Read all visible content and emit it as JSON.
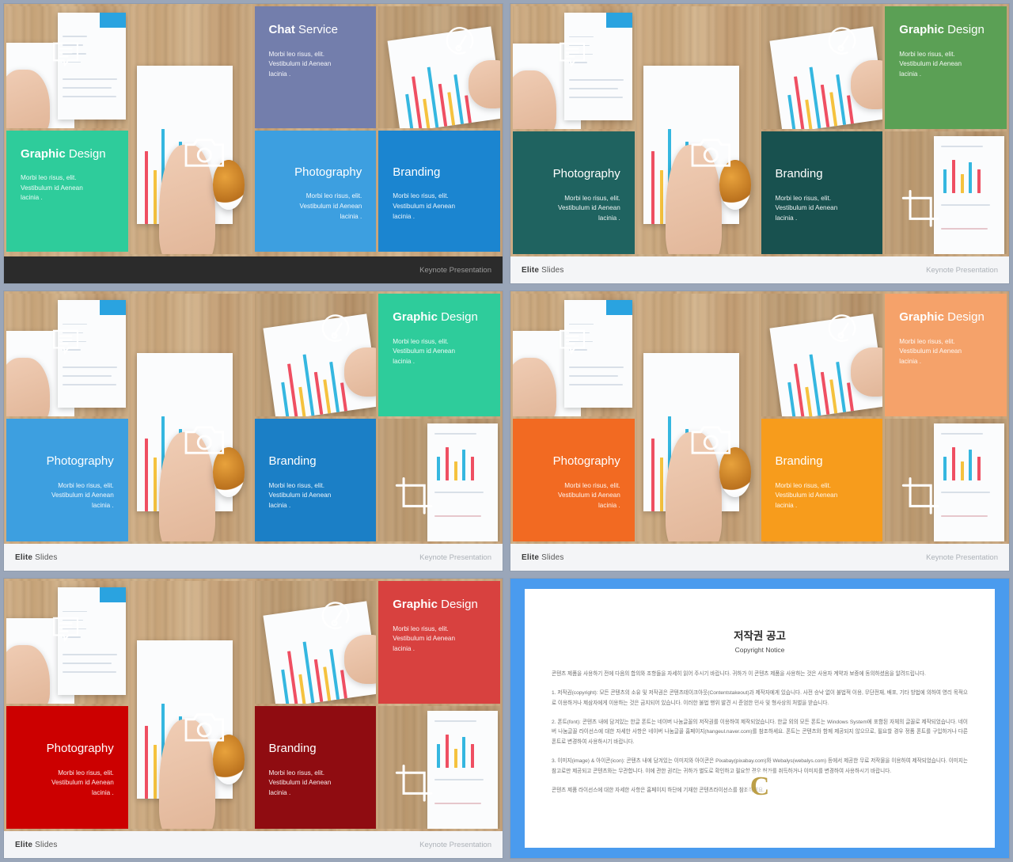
{
  "meta": {
    "gap_color": "#9aa6b9"
  },
  "tiles": {
    "chat": {
      "title_bold": "Chat",
      "title_rest": " Service",
      "body": "Morbi leo risus, elit.\nVestibulum id Aenean\nlacinia ."
    },
    "graphic": {
      "title_bold": "Graphic",
      "title_rest": " Design",
      "body": "Morbi leo risus, elit.\nVestibulum id Aenean\nlacinia ."
    },
    "photography": {
      "title_bold": "",
      "title_rest": "Photography",
      "body": "Morbi leo risus, elit.\nVestibulum id Aenean\nlacinia ."
    },
    "branding": {
      "title_bold": "",
      "title_rest": "Branding",
      "body": "Morbi leo risus, elit.\nVestibulum id Aenean\nlacinia ."
    }
  },
  "footer": {
    "brand_bold": "Elite",
    "brand_rest": " Slides",
    "note": "Keynote Presentation"
  },
  "slides": [
    {
      "id": "slide-blue-purple",
      "theme": "dark-footer",
      "footer_brand_visible": false,
      "colors": {
        "chat": "#737eac",
        "graphic": "#2ecc9b",
        "photography": "#3d9fe0",
        "branding": "#1b85d0"
      }
    },
    {
      "id": "slide-navy-teal",
      "theme": "light-footer",
      "footer_brand_visible": true,
      "colors": {
        "chat": "#102437",
        "graphic": "#5ba055",
        "photography": "#1f6360",
        "branding": "#18514f"
      }
    },
    {
      "id": "slide-periwinkle-green",
      "theme": "light-footer",
      "footer_brand_visible": true,
      "colors": {
        "chat": "#6d78a7",
        "graphic": "#2ecc9b",
        "photography": "#3d9fe0",
        "branding": "#1b7fc6"
      }
    },
    {
      "id": "slide-yellow-orange",
      "theme": "light-footer",
      "footer_brand_visible": true,
      "colors": {
        "chat": "#f5cc17",
        "graphic": "#f5a26a",
        "photography": "#f26a22",
        "branding": "#f79c1c"
      }
    },
    {
      "id": "slide-red-crimson",
      "theme": "light-footer",
      "footer_brand_visible": true,
      "colors": {
        "chat": "#d4706b",
        "graphic": "#d8413f",
        "photography": "#cc0000",
        "branding": "#8f0c11"
      }
    }
  ],
  "copyright_slide": {
    "background": "#4a9bee",
    "title": "저작권 공고",
    "subtitle": "Copyright Notice",
    "watermark": "C",
    "paragraphs": [
      "콘텐츠 제품을 사용하기 전에 다음의 합의와 조항들을 자세히 읽어 주시기 바랍니다. 귀하가 이 콘텐츠 제품을 사용하는 것은 사용자 계약과 보증에 동의하셨음을 알려드립니다.",
      "1. 저작권(copyright): 모든 콘텐츠의 소유 및 저작권은 콘텐츠테이크아웃(Contentstakeout)과 제작자에게 있습니다. 사전 승낙 없이 불법적 이용, 무단전재, 배포, 기타 방법에 의하여 영리 목적으로 이용하거나 제삼자에게 이용하는 것은 금지되어 있습니다. 이러한 불법 행위 발견 시 준엄한 민사 및 형사상의 처벌을 받습니다.",
      "2. 폰트(font): 콘텐츠 내에 담겨있는 한글 폰트는 네이버 나눔글꼴의 저작권를 이용하여 제작되었습니다. 한글 외의 모든 폰트는 Windows System에 포함된 자체의 글꼴로 제작되었습니다. 네이버 나눔글꼴 라이선스에 대한 자세한 사항은 네이버 나눔글꼴 홈페이지(hangeul.naver.com)를 참조하세요. 폰트는 콘텐츠와 함께 제공되지 않으므로, 필요할 경우 정품 폰트를 구입하거나 다른 폰트로 변경하여 사용하시기 바랍니다.",
      "3. 이미지(image) & 아이콘(icon): 콘텐츠 내에 담겨있는 이미지와 아이콘은 Pixabay(pixabay.com)와 Webalys(webalys.com) 등에서 제공한 무료 저작물을 이용하여 제작되었습니다. 이미지는 참고로만 제공되고 콘텐츠와는 무관합니다. 이에 관한 권리는 귀하가 별도로 확인하고 필요할 경우 허가를 취득하거나 이미지를 변경하여 사용하시기 바랍니다.",
      "콘텐츠 제품 라이선스에 대한 자세한 사항은 홈페이지 하단에 기재한 콘텐츠라이선스를 참조하세요."
    ]
  },
  "icons": {
    "chat_bubble": "chat-bubble-icon",
    "gauge": "gauge-icon",
    "camera": "camera-icon",
    "crop": "crop-icon"
  }
}
